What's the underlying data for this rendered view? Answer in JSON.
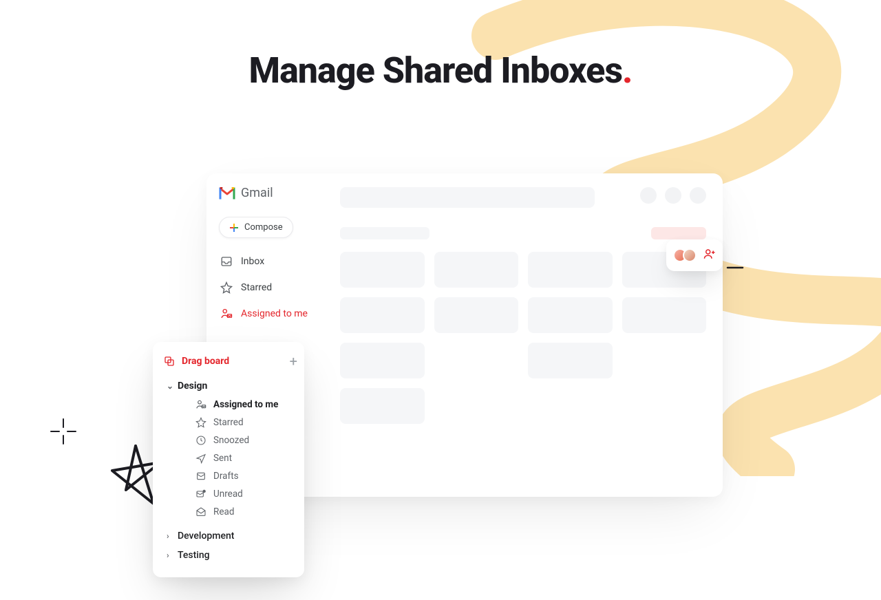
{
  "headline": "Manage Shared Inboxes",
  "brand": {
    "name": "Gmail"
  },
  "compose_label": "Compose",
  "sidebar": {
    "inbox": "Inbox",
    "starred": "Starred",
    "assigned": "Assigned to me"
  },
  "drag_board": {
    "title": "Drag board",
    "sections": {
      "design": "Design",
      "development": "Development",
      "testing": "Testing"
    },
    "design_items": {
      "assigned": "Assigned to me",
      "starred": "Starred",
      "snoozed": "Snoozed",
      "sent": "Sent",
      "drafts": "Drafts",
      "unread": "Unread",
      "read": "Read"
    }
  }
}
